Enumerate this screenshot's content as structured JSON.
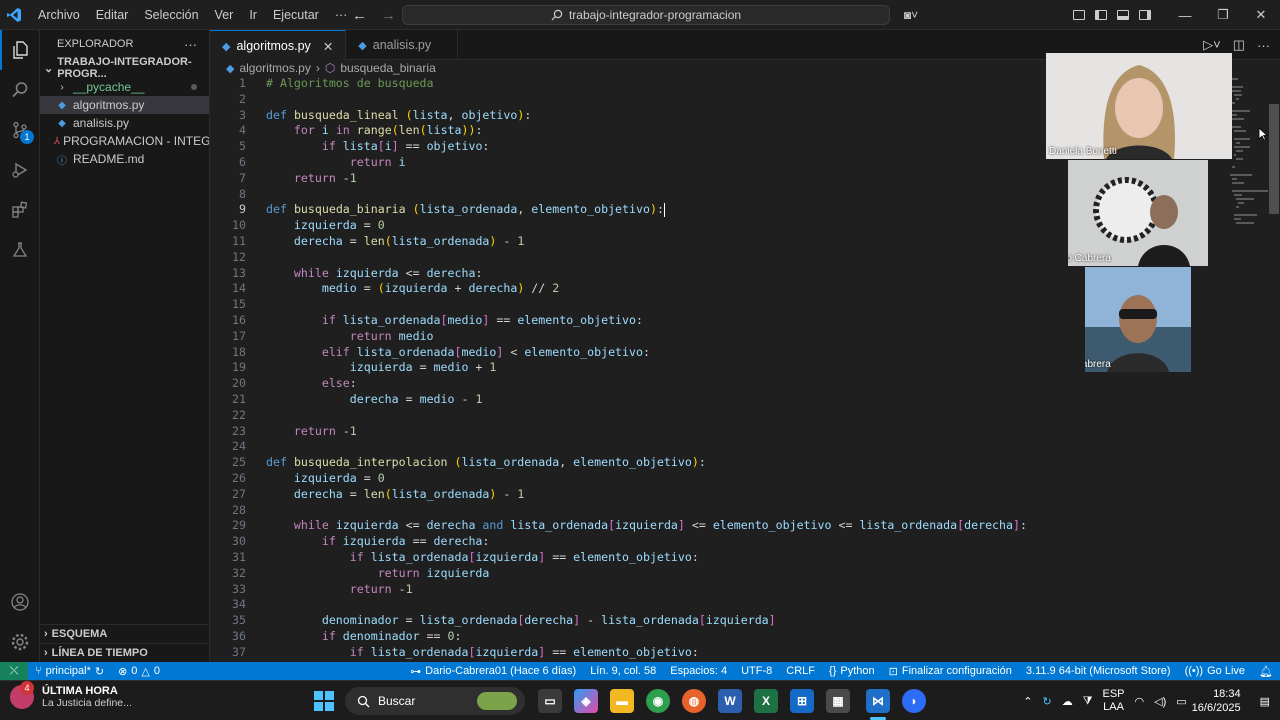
{
  "titlebar": {
    "menu": [
      "Archivo",
      "Editar",
      "Selección",
      "Ver",
      "Ir",
      "Ejecutar",
      "···"
    ],
    "search_text": "trabajo-integrador-programacion"
  },
  "explorer": {
    "title": "EXPLORADOR",
    "project": "TRABAJO-INTEGRADOR-PROGR...",
    "items": [
      {
        "label": "__pycache__",
        "type": "folder"
      },
      {
        "label": "algoritmos.py",
        "type": "py"
      },
      {
        "label": "analisis.py",
        "type": "py"
      },
      {
        "label": "PROGRAMACION - INTEGR...",
        "type": "pdf"
      },
      {
        "label": "README.md",
        "type": "md"
      }
    ],
    "outline": "ESQUEMA",
    "timeline": "LÍNEA DE TIEMPO"
  },
  "activity_badge": "1",
  "tabs": [
    {
      "label": "algoritmos.py",
      "active": true
    },
    {
      "label": "analisis.py",
      "active": false
    }
  ],
  "breadcrumbs": {
    "file": "algoritmos.py",
    "symbol": "busqueda_binaria"
  },
  "code_lines": [
    "# Algoritmos de busqueda",
    "",
    "def busqueda_lineal (lista, objetivo):",
    "    for i in range(len(lista)):",
    "        if lista[i] == objetivo:",
    "            return i",
    "    return -1",
    "",
    "def busqueda_binaria (lista_ordenada, elemento_objetivo):",
    "    izquierda = 0",
    "    derecha = len(lista_ordenada) - 1",
    "",
    "    while izquierda <= derecha:",
    "        medio = (izquierda + derecha) // 2",
    "",
    "        if lista_ordenada[medio] == elemento_objetivo:",
    "            return medio",
    "        elif lista_ordenada[medio] < elemento_objetivo:",
    "            izquierda = medio + 1",
    "        else:",
    "            derecha = medio - 1",
    "",
    "    return -1",
    "",
    "def busqueda_interpolacion (lista_ordenada, elemento_objetivo):",
    "    izquierda = 0",
    "    derecha = len(lista_ordenada) - 1",
    "",
    "    while izquierda <= derecha and lista_ordenada[izquierda] <= elemento_objetivo <= lista_ordenada[derecha]:",
    "        if izquierda == derecha:",
    "            if lista_ordenada[izquierda] == elemento_objetivo:",
    "                return izquierda",
    "            return -1",
    "",
    "        denominador = lista_ordenada[derecha] - lista_ordenada[izquierda]",
    "        if denominador == 0:",
    "            if lista_ordenada[izquierda] == elemento_objetivo:"
  ],
  "current_line": 9,
  "participants": [
    {
      "name": "Daniela Bonetti"
    },
    {
      "name": "Dario Cabrera"
    },
    {
      "name": "Dario Cabrera"
    }
  ],
  "statusbar": {
    "branch": "principal*",
    "problems": "0",
    "warnings": "0",
    "blame": "Dario-Cabrera01 (Hace 6 días)",
    "position": "Lín. 9, col. 58",
    "spaces": "Espacios: 4",
    "encoding": "UTF-8",
    "eol": "CRLF",
    "language": "Python",
    "config": "Finalizar configuración",
    "interpreter": "3.11.9 64-bit (Microsoft Store)",
    "golive": "Go Live"
  },
  "taskbar": {
    "news_badge": "4",
    "news_title": "ÚLTIMA HORA",
    "news_sub": "La Justicia define...",
    "search": "Buscar",
    "lang1": "ESP",
    "lang2": "LAA",
    "time": "18:34",
    "date": "16/6/2025"
  }
}
